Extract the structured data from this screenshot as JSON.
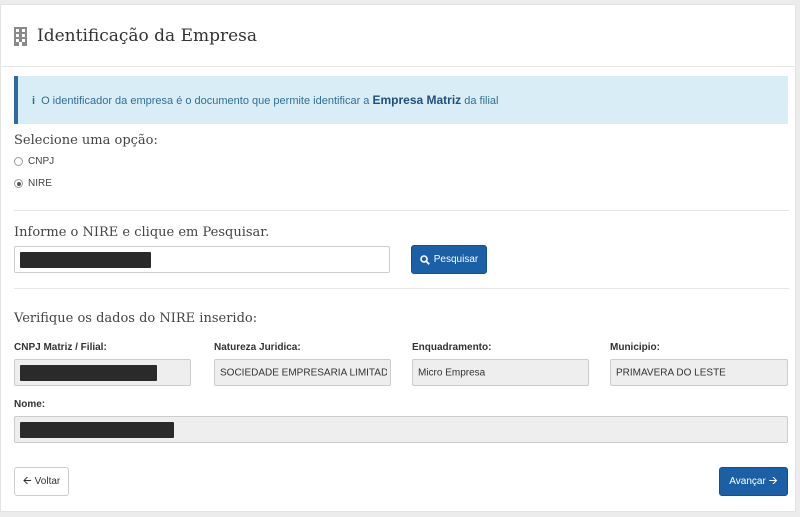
{
  "header": {
    "title": "Identificação da Empresa",
    "icon": "building-icon"
  },
  "info": {
    "icon": "info-icon",
    "text_before": "O identificador da empresa é o documento que permite identificar a ",
    "emphasis": "Empresa Matriz",
    "text_after": " da filial"
  },
  "options": {
    "label": "Selecione uma opção:",
    "items": [
      {
        "label": "CNPJ",
        "selected": false
      },
      {
        "label": "NIRE",
        "selected": true
      }
    ]
  },
  "search": {
    "label": "Informe o NIRE e clique em Pesquisar.",
    "button_label": "Pesquisar",
    "button_icon": "search-icon"
  },
  "details": {
    "label": "Verifique os dados do NIRE inserido:",
    "fields": {
      "cnpj": {
        "label": "CNPJ Matriz / Filial:"
      },
      "natureza": {
        "label": "Natureza Juridica:",
        "value": "SOCIEDADE EMPRESARIA LIMITADA"
      },
      "enquadramento": {
        "label": "Enquadramento:",
        "value": "Micro Empresa"
      },
      "municipio": {
        "label": "Municipio:",
        "value": "PRIMAVERA DO LESTE"
      },
      "nome": {
        "label": "Nome:"
      }
    }
  },
  "footer": {
    "back_label": "Voltar",
    "back_icon": "arrow-left-icon",
    "next_label": "Avançar",
    "next_icon": "arrow-right-icon"
  },
  "colors": {
    "primary": "#1b5fa6",
    "info_bg": "#d9edf7",
    "info_border": "#2f6ba0"
  }
}
